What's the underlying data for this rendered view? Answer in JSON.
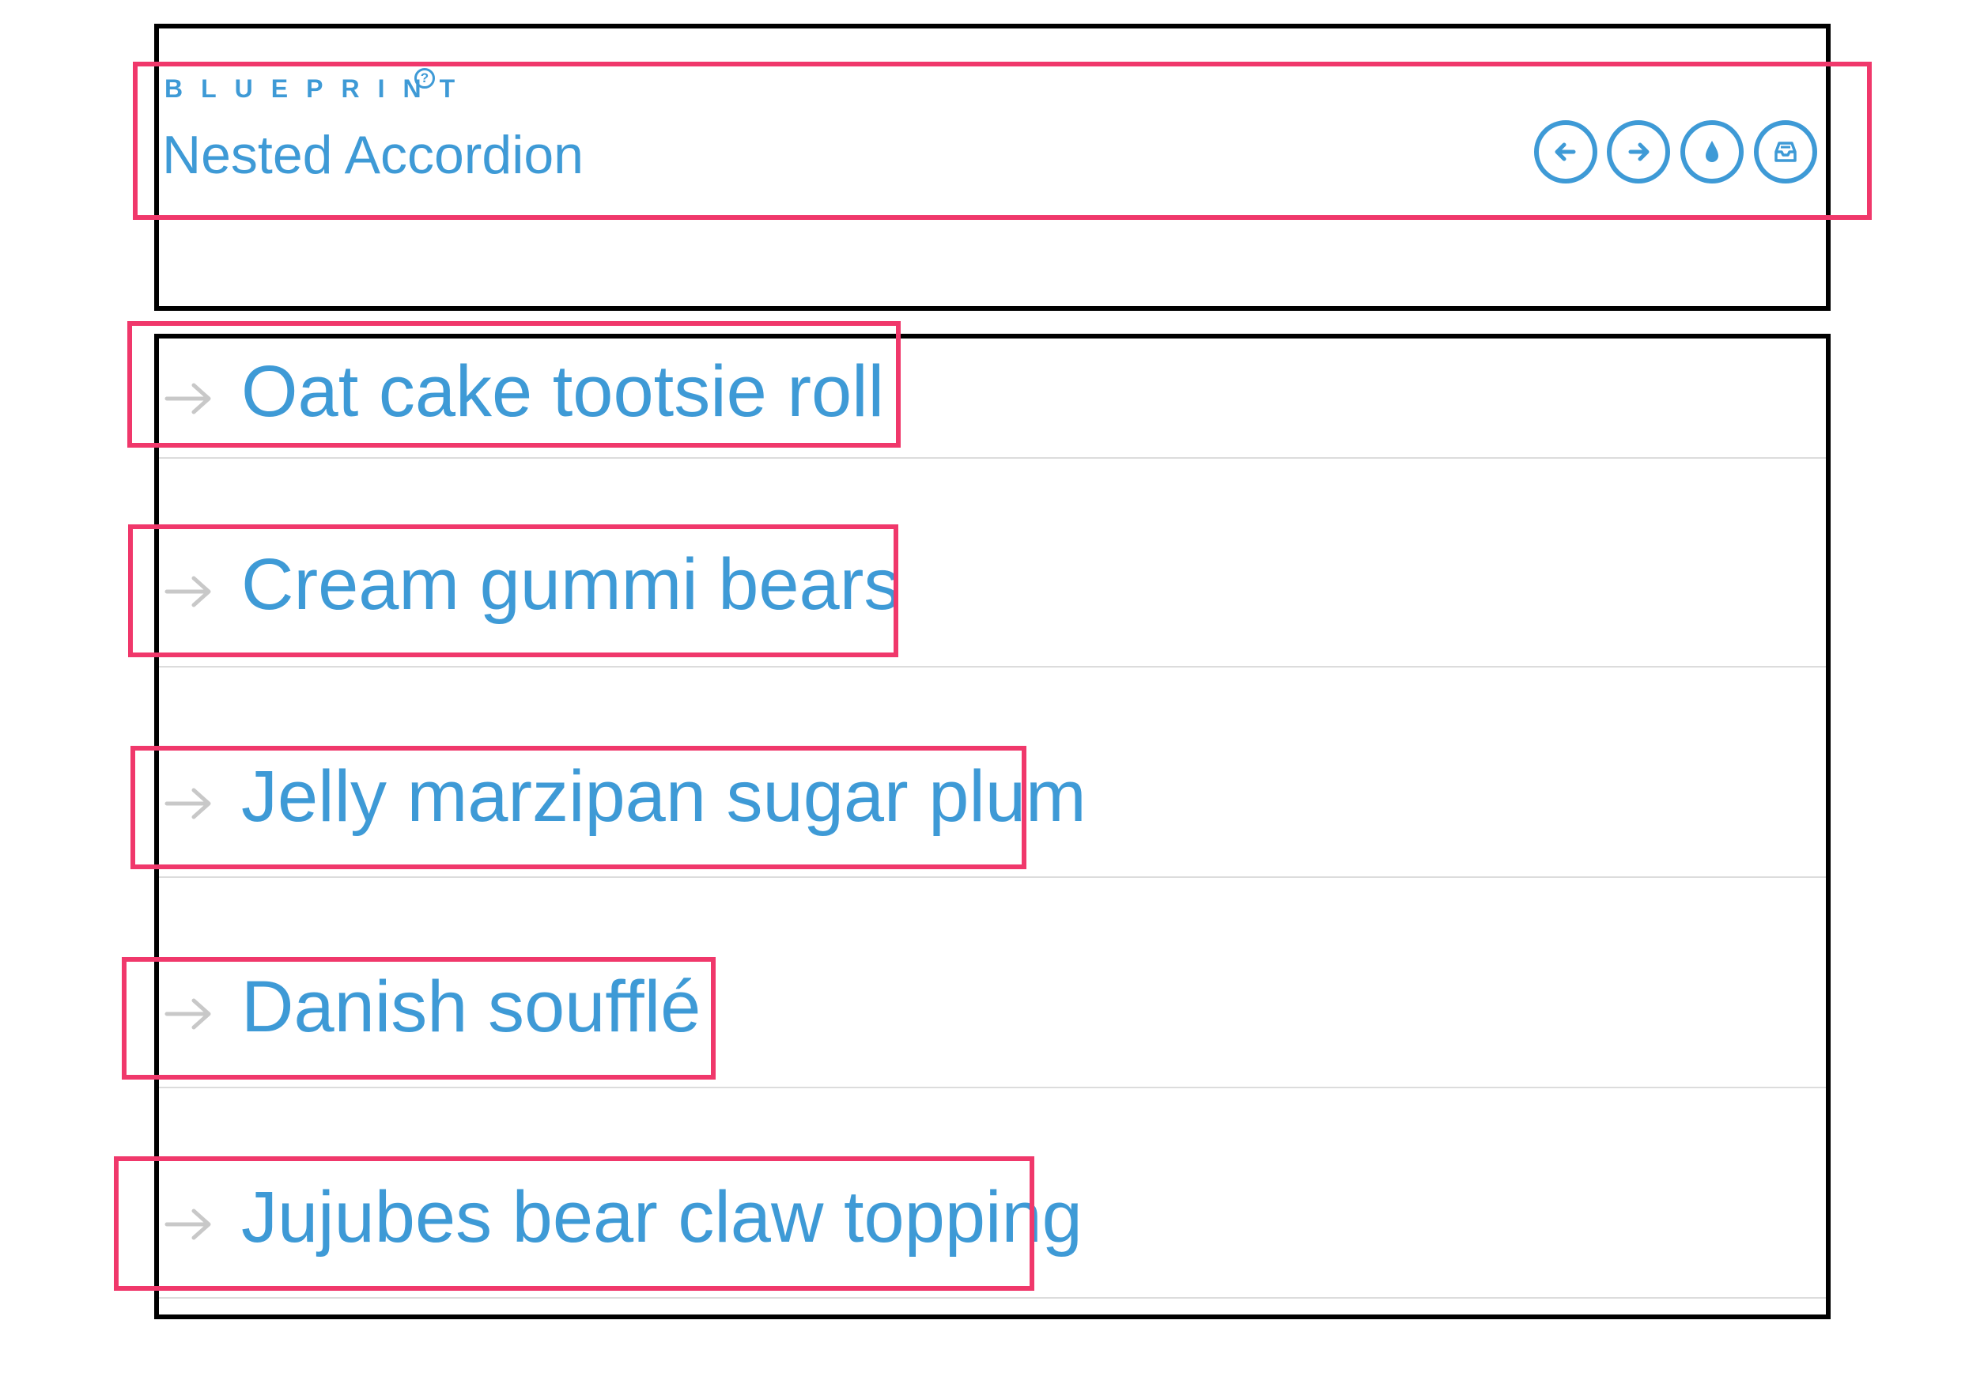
{
  "header": {
    "brand": "BLUEPRINT",
    "brand_mark": "?",
    "title": "Nested Accordion",
    "actions": [
      {
        "icon": "arrow-left-icon",
        "label": "Previous"
      },
      {
        "icon": "arrow-right-icon",
        "label": "Next"
      },
      {
        "icon": "drop-icon",
        "label": "Theme"
      },
      {
        "icon": "inbox-icon",
        "label": "Archive"
      }
    ]
  },
  "accordion": {
    "items": [
      {
        "label": "Oat cake tootsie roll"
      },
      {
        "label": "Cream gummi bears"
      },
      {
        "label": "Jelly marzipan sugar plum"
      },
      {
        "label": "Danish soufflé"
      },
      {
        "label": "Jujubes bear claw topping"
      }
    ]
  },
  "colors": {
    "accent": "#3e9ad6",
    "arrow": "#c8c8c8",
    "divider": "#dcdcdc",
    "highlight": "#f0386b",
    "frame": "#000000"
  }
}
